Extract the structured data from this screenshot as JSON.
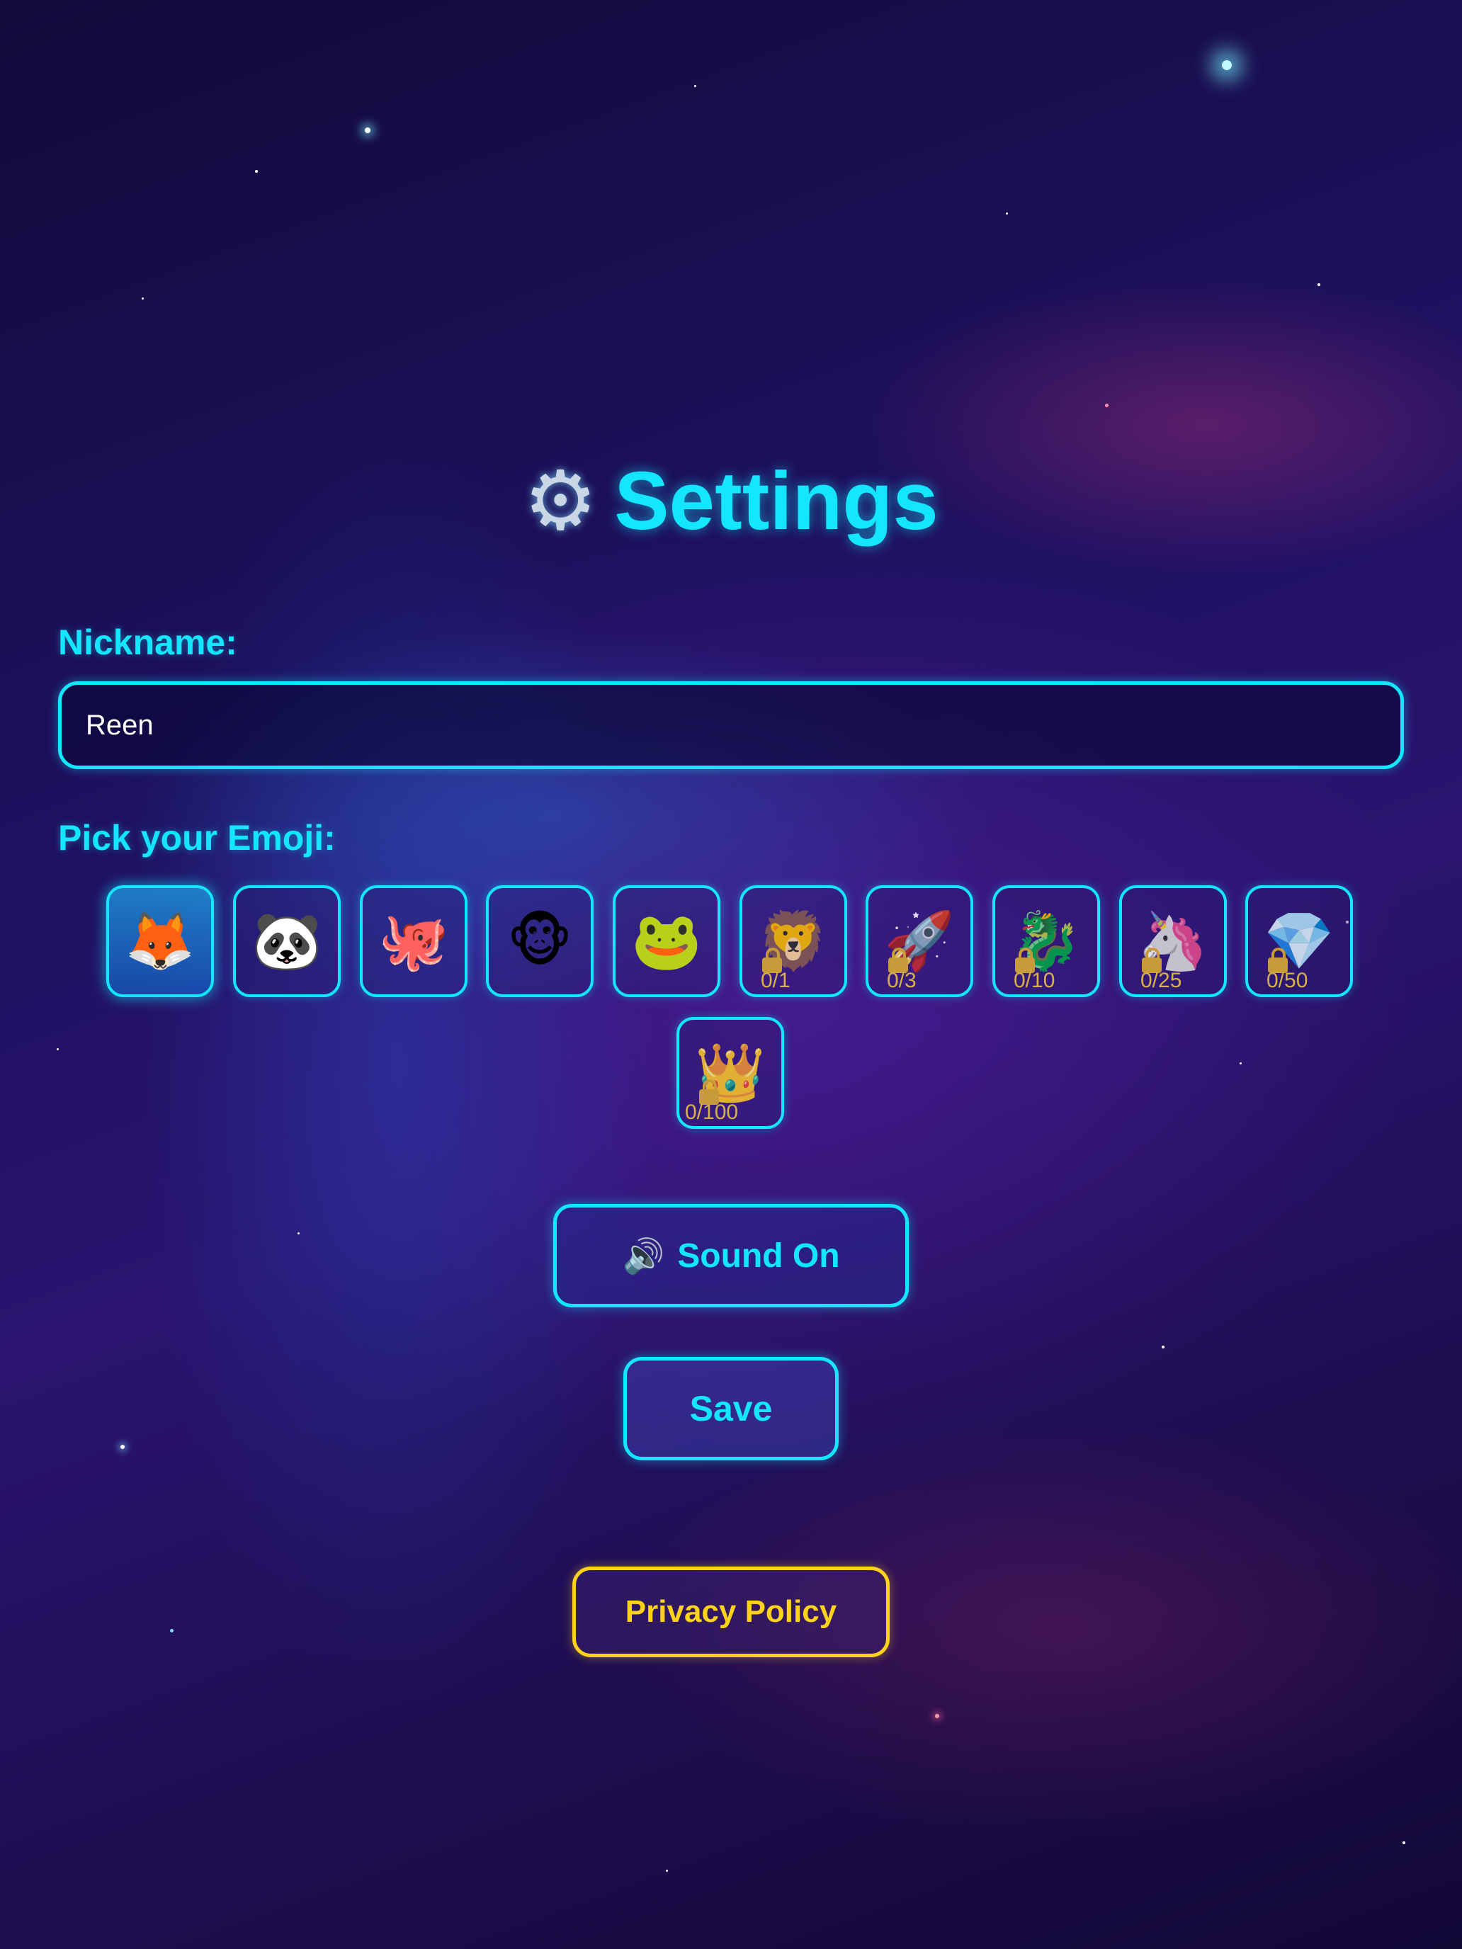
{
  "header": {
    "title": "Settings",
    "icon": "gear-icon"
  },
  "nickname": {
    "label": "Nickname:",
    "value": "Reen"
  },
  "emoji_picker": {
    "label": "Pick your Emoji:",
    "selected": "fox",
    "items": [
      {
        "name": "fox",
        "glyph": "🦊",
        "locked": false,
        "progress": ""
      },
      {
        "name": "panda",
        "glyph": "🐼",
        "locked": false,
        "progress": ""
      },
      {
        "name": "octopus",
        "glyph": "🐙",
        "locked": false,
        "progress": ""
      },
      {
        "name": "monkey",
        "glyph": "🐵",
        "locked": false,
        "progress": ""
      },
      {
        "name": "frog",
        "glyph": "🐸",
        "locked": false,
        "progress": ""
      },
      {
        "name": "lion",
        "glyph": "🦁",
        "locked": true,
        "progress": "0/1"
      },
      {
        "name": "rocket",
        "glyph": "🚀",
        "locked": true,
        "progress": "0/3"
      },
      {
        "name": "dragon",
        "glyph": "🐉",
        "locked": true,
        "progress": "0/10"
      },
      {
        "name": "unicorn",
        "glyph": "🦄",
        "locked": true,
        "progress": "0/25"
      },
      {
        "name": "diamond",
        "glyph": "💎",
        "locked": true,
        "progress": "0/50"
      },
      {
        "name": "crown",
        "glyph": "👑",
        "locked": true,
        "progress": "0/100"
      }
    ]
  },
  "sound_button": {
    "icon": "speaker-icon",
    "icon_glyph": "🔊",
    "label": "Sound On"
  },
  "save_button": {
    "label": "Save"
  },
  "privacy_button": {
    "label": "Privacy Policy"
  },
  "colors": {
    "accent": "#14e6ff",
    "privacy": "#ffd21a",
    "progress_text": "#d7b04a"
  }
}
